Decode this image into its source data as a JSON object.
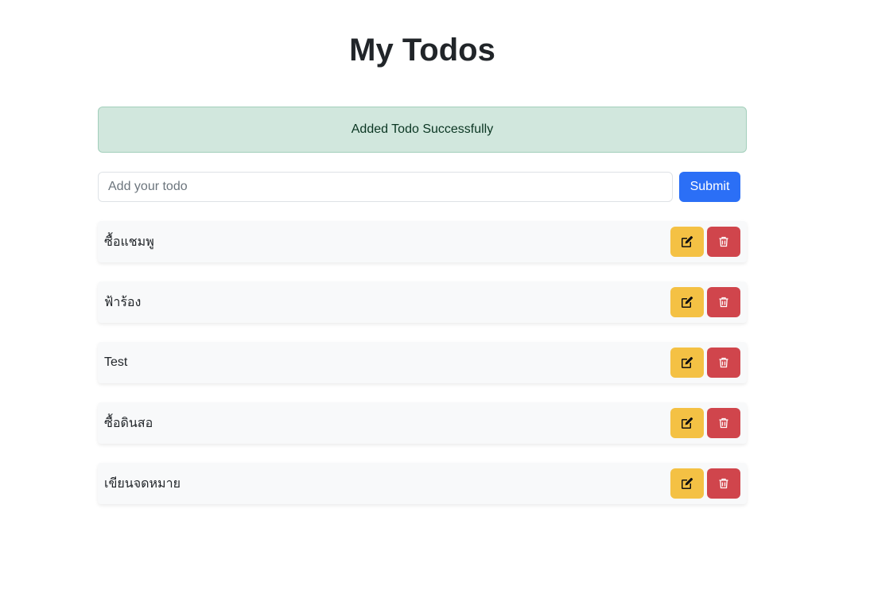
{
  "header": {
    "title": "My Todos"
  },
  "alert": {
    "message": "Added Todo Successfully"
  },
  "form": {
    "input_value": "",
    "input_placeholder": "Add your todo",
    "submit_label": "Submit"
  },
  "todos": [
    {
      "text": "ซื้อแชมพู"
    },
    {
      "text": "ฟ้าร้อง"
    },
    {
      "text": "Test"
    },
    {
      "text": "ซื้อดินสอ"
    },
    {
      "text": "เขียนจดหมาย"
    }
  ],
  "icons": {
    "edit": "pencil-square-icon",
    "delete": "trash-icon"
  },
  "colors": {
    "primary": "#2b6ff6",
    "warning": "#f4c144",
    "danger": "#d0454c",
    "success_bg": "#d1e7dd"
  }
}
